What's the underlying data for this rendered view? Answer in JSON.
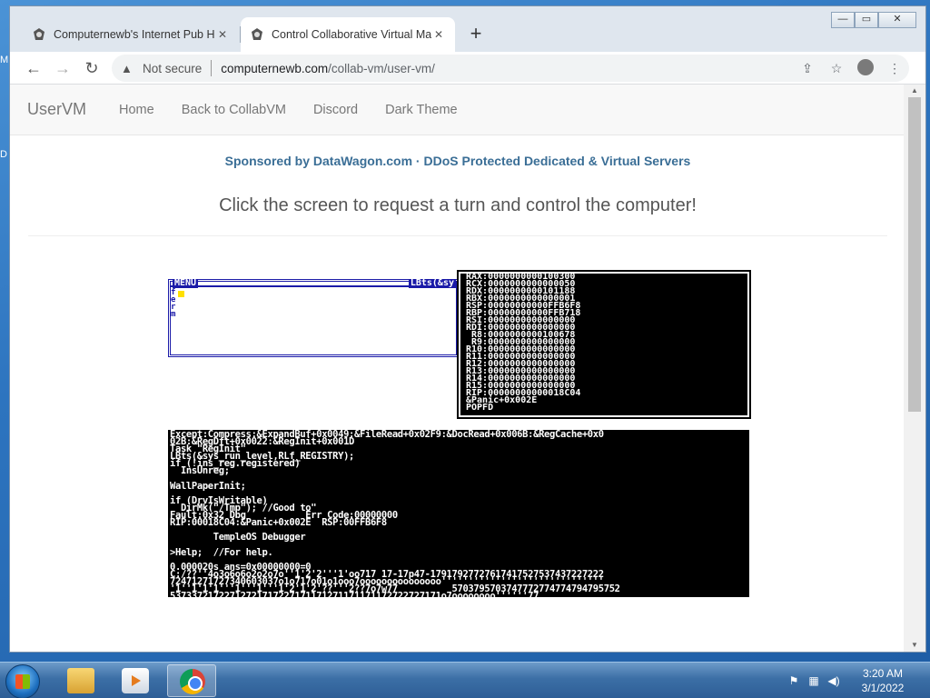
{
  "desktop": {
    "fragments": [
      "M",
      "D"
    ]
  },
  "browser": {
    "tabs": [
      {
        "title": "Computernewb's Internet Pub Hu",
        "active": false
      },
      {
        "title": "Control Collaborative Virtual Ma",
        "active": true
      }
    ],
    "new_tab": "+",
    "window_controls": {
      "minimize": "—",
      "maximize": "▭",
      "close": "✕"
    },
    "toolbar": {
      "back": "←",
      "forward": "→",
      "reload": "↻",
      "security_label": "Not secure",
      "url_host": "computernewb.com",
      "url_path": "/collab-vm/user-vm/"
    }
  },
  "page": {
    "navbar": {
      "brand": "UserVM",
      "links": [
        "Home",
        "Back to CollabVM",
        "Discord",
        "Dark Theme"
      ]
    },
    "sponsor_text": "Sponsored by DataWagon.com · DDoS Protected Dedicated & Virtual Servers",
    "prompt_text": "Click the screen to request a turn and control the computer!",
    "vm": {
      "menu_title": "MENU",
      "menu_right": "LBts(&sy",
      "menu_side_letters": "f\ne\nr\nm",
      "registers": [
        "RAX:0000000000100300",
        "RCX:0000000000000050",
        "RDX:0000000000101188",
        "RBX:0000000000000001",
        "RSP:00000000000FFB6F8",
        "RBP:00000000000FFB718",
        "RSI:0000000000000000",
        "RDI:0000000000000000",
        " R8:0000000000100678",
        " R9:0000000000000000",
        "R10:0000000000000000",
        "R11:0000000000000000",
        "R12:0000000000000000",
        "R13:0000000000000000",
        "R14:0000000000000000",
        "R15:0000000000000000",
        "RIP:00000000000018C04",
        "&Panic+0x002E",
        "POPFD"
      ],
      "console": [
        "Except:Compress:&ExpandBuf+0x0049:&FileRead+0x02F9:&DocRead+0x006B:&RegCache+0x0",
        "02B:&RegDft+0x0022:&RegInit+0x001D",
        "Task \"RegInit\"",
        "LBts(&sys_run_level,RLf_REGISTRY);",
        "if (!ins_reg.registered)",
        "  InsUnreg;",
        "",
        "WallPaperInit;",
        "",
        "if (DrvIsWritable)",
        "  DirMk(\"/Tmp\"); //Good to\"",
        "Fault:0x32 Dbg           Err Code:00000000",
        "RIP:00018C04:&Panic+0x002E  RSP:00FFB6F8",
        "",
        "        TempleOS Debugger",
        "",
        ">Help;  //For help.",
        "",
        "0.000020s ans=0x00000000=0",
        "C:/??''4o3o6o6o2o2o7o''1'2'2'''1'oo717 17-17p47-17917927727617417527537437227222",
        "72471271727340603037o1o717o01o1ooo7ooooooooooooooo''''''''''''''''''''''''''''''",
        "'1''1'1'1'''1'''1'''1'2'1'2'??'''2??7o7w77          5703795703747772774774794795752",
        "53733721722712721717227171171271171171172722727171o7oooooooo''''''77"
      ]
    }
  },
  "taskbar": {
    "time": "3:20 AM",
    "date": "3/1/2022",
    "tray_icons": [
      "flag-icon",
      "network-icon",
      "volume-icon"
    ]
  }
}
